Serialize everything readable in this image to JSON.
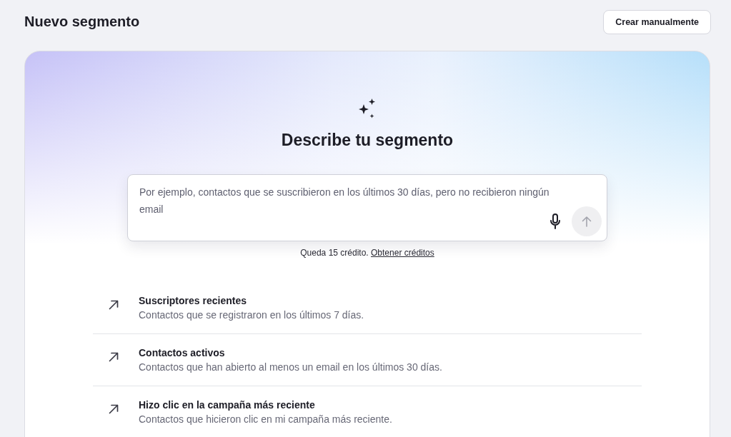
{
  "header": {
    "title": "Nuevo segmento",
    "create_button": "Crear manualmente"
  },
  "prompt": {
    "heading": "Describe tu segmento",
    "placeholder": "Por ejemplo, contactos que se suscribieron en los últimos 30 días, pero no recibieron ningún email",
    "send_button": {
      "disabled": true
    },
    "credits": "Queda 15 crédito.",
    "credits_link": "Obtener créditos"
  },
  "suggestions": [
    {
      "title": "Suscriptores recientes",
      "description": "Contactos que se registraron en los últimos 7 días."
    },
    {
      "title": "Contactos activos",
      "description": "Contactos que han abierto al menos un email en los últimos 30 días."
    },
    {
      "title": "Hizo clic en la campaña más reciente",
      "description": "Contactos que hicieron clic en mi campaña más reciente."
    }
  ]
}
